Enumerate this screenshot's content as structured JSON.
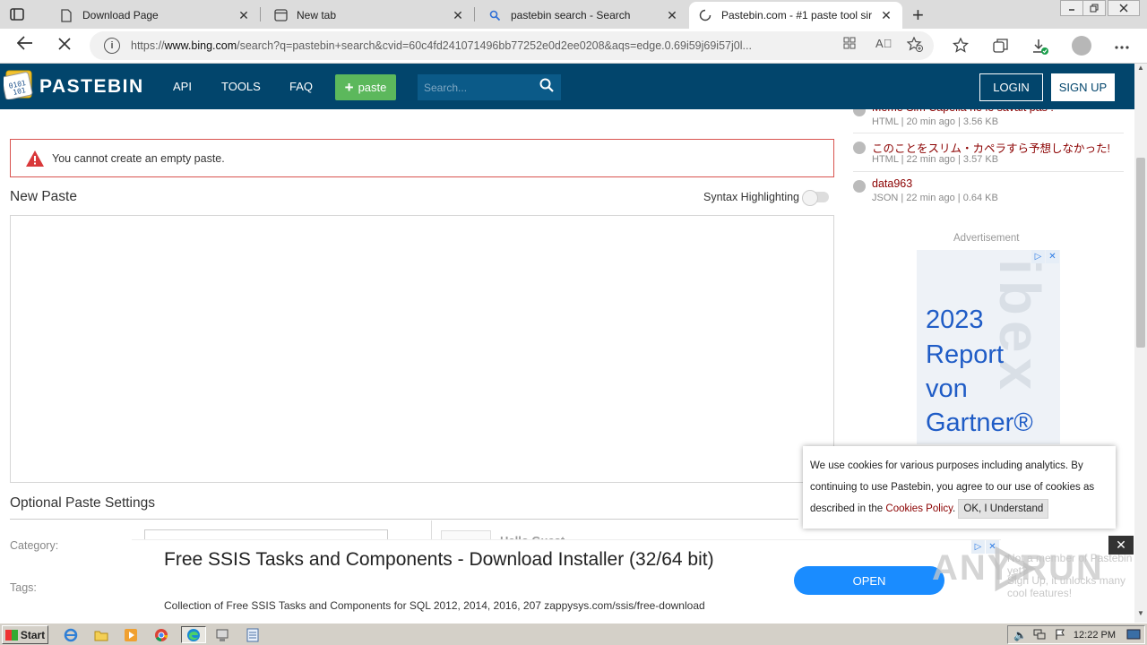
{
  "browser": {
    "tabs": [
      {
        "title": "Download Page",
        "icon": "page-icon",
        "active": false
      },
      {
        "title": "New tab",
        "icon": "newtab-icon",
        "active": false
      },
      {
        "title": "pastebin search - Search",
        "icon": "bing-search-icon",
        "active": false
      },
      {
        "title": "Pastebin.com - #1 paste tool sir",
        "icon": "loading-icon",
        "active": true
      }
    ],
    "close_glyph": "✕",
    "new_tab_glyph": "+",
    "url_prefix": "https://",
    "url_domain": "www.bing.com",
    "url_rest": "/search?q=pastebin+search&cvid=60c4fd241071496bb77252e0d2ee0208&aqs=edge.0.69i59j69i57j0l..."
  },
  "pastebin": {
    "brand": "PASTEBIN",
    "nav": [
      "API",
      "TOOLS",
      "FAQ"
    ],
    "paste_button": "paste",
    "search_placeholder": "Search...",
    "login": "LOGIN",
    "signup": "SIGN UP",
    "alert_text": "You cannot create an empty paste.",
    "new_paste_title": "New Paste",
    "syntax_label": "Syntax Highlighting",
    "optional_title": "Optional Paste Settings",
    "category_label": "Category:",
    "tags_label": "Tags:",
    "guest_text": "Hello Guest",
    "recent": [
      {
        "name": "Meme Sim Capella ne le savait pas !",
        "meta": "HTML | 20 min ago | 3.56 KB"
      },
      {
        "name": "このことをスリム・カペラすら予想しなかった!",
        "meta": "HTML | 22 min ago | 3.57 KB"
      },
      {
        "name": "data963",
        "meta": "JSON | 22 min ago | 0.64 KB"
      }
    ],
    "advertisement_label": "Advertisement",
    "ad_lines": [
      "2023",
      "Report",
      "von",
      "Gartner®"
    ]
  },
  "cookie": {
    "text": "We use cookies for various purposes including analytics. By continuing to use Pastebin, you agree to our use of cookies as described in the",
    "link": "Cookies Policy",
    "period": ".",
    "ok": "OK, I Understand"
  },
  "bottom_ad": {
    "headline": "Free SSIS Tasks and Components - Download Installer (32/64 bit)",
    "description": "Collection of Free SSIS Tasks and Components for SQL 2012, 2014, 2016, 207 zappysys.com/ssis/free-download",
    "open": "OPEN",
    "close_glyph": "✕",
    "faded_1": "Not a member of Pastebin yet?",
    "faded_2": "Sign Up, it unlocks many cool features!"
  },
  "taskbar": {
    "start": "Start",
    "clock": "12:22 PM"
  },
  "watermark": "ANY.RUN"
}
